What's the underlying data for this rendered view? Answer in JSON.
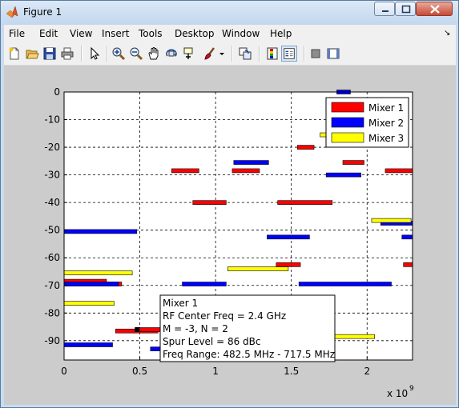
{
  "window": {
    "title": "Figure 1"
  },
  "menu": [
    "File",
    "Edit",
    "View",
    "Insert",
    "Tools",
    "Desktop",
    "Window",
    "Help"
  ],
  "toolbar_icons": [
    "new-figure-icon",
    "open-file-icon",
    "save-icon",
    "print-icon",
    "edit-plot-arrow-icon",
    "zoom-in-icon",
    "zoom-out-icon",
    "pan-hand-icon",
    "rotate-3d-icon",
    "data-cursor-icon",
    "brush-icon",
    "brush-dropdown-icon",
    "link-plot-icon",
    "insert-colorbar-icon",
    "insert-legend-icon",
    "hide-plot-tools-icon",
    "show-plot-tools-icon"
  ],
  "colors": {
    "mixer1": "#ff0000",
    "mixer2": "#0000ff",
    "mixer3": "#ffff00"
  },
  "chart_data": {
    "type": "bar",
    "xlim": [
      0,
      2300000000
    ],
    "ylim": [
      -97,
      0
    ],
    "x_ticks": [
      "0",
      "0.5",
      "1",
      "1.5",
      "2"
    ],
    "x_exponent": "x 10",
    "x_exponent_power": "9",
    "y_ticks": [
      "0",
      "-10",
      "-20",
      "-30",
      "-40",
      "-50",
      "-60",
      "-70",
      "-80",
      "-90"
    ],
    "grid": true,
    "legend_position": "top-right",
    "series": [
      {
        "name": "Mixer 1",
        "color": "#ff0000",
        "segments": [
          [
            0,
            280000000,
            -68.5
          ],
          [
            0,
            380000000,
            -69.5
          ],
          [
            340000000,
            620000000,
            -86.5
          ],
          [
            490000000,
            780000000,
            -86
          ],
          [
            710000000,
            890000000,
            -28.5
          ],
          [
            850000000,
            1070000000,
            -40
          ],
          [
            1110000000,
            1290000000,
            -28.5
          ],
          [
            1400000000,
            1560000000,
            -62.5
          ],
          [
            1410000000,
            1770000000,
            -40
          ],
          [
            1540000000,
            1650000000,
            -20
          ],
          [
            1840000000,
            1980000000,
            -25.5
          ],
          [
            2120000000,
            2300000000,
            -28.5
          ],
          [
            2240000000,
            2300000000,
            -62.5
          ]
        ]
      },
      {
        "name": "Mixer 2",
        "color": "#0000ff",
        "segments": [
          [
            0,
            480000000,
            -50.5
          ],
          [
            0,
            360000000,
            -69.5
          ],
          [
            0,
            320000000,
            -91.5
          ],
          [
            570000000,
            700000000,
            -93
          ],
          [
            780000000,
            1070000000,
            -69.5
          ],
          [
            1120000000,
            1350000000,
            -25.5
          ],
          [
            1340000000,
            1620000000,
            -52.5
          ],
          [
            1550000000,
            2160000000,
            -69.5
          ],
          [
            1730000000,
            1960000000,
            -30
          ],
          [
            1800000000,
            1890000000,
            0
          ],
          [
            2090000000,
            2300000000,
            -47.5
          ],
          [
            2230000000,
            2300000000,
            -52.5
          ]
        ]
      },
      {
        "name": "Mixer 3",
        "color": "#ffff00",
        "segments": [
          [
            0,
            450000000,
            -65.5
          ],
          [
            0,
            330000000,
            -76.5
          ],
          [
            1080000000,
            1480000000,
            -64
          ],
          [
            1690000000,
            1750000000,
            -15.5
          ],
          [
            1780000000,
            2050000000,
            -88.5
          ],
          [
            2030000000,
            2290000000,
            -46.5
          ]
        ]
      }
    ],
    "datatip": {
      "lines": [
        "Mixer 1",
        "RF Center Freq = 2.4 GHz",
        "M = -3, N = 2",
        "Spur Level = 86 dBc",
        "Freq Range: 482.5 MHz - 717.5 MHz"
      ],
      "anchor_x": 482500000,
      "anchor_y": -86
    }
  }
}
